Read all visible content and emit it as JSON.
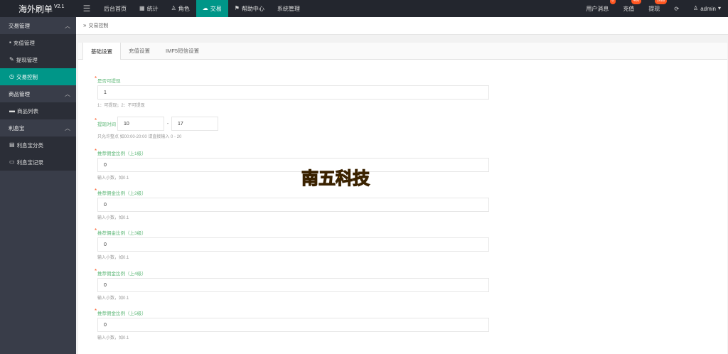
{
  "app": {
    "title": "海外刷单",
    "version": "V2.1"
  },
  "topnav": [
    {
      "label": "后台首页",
      "icon": "home-icon"
    },
    {
      "label": "统计",
      "icon": "chart-icon"
    },
    {
      "label": "角色",
      "icon": "user-icon"
    },
    {
      "label": "交易",
      "icon": "cloud-icon",
      "active": true
    },
    {
      "label": "帮助中心",
      "icon": "flag-icon"
    },
    {
      "label": "系统管理",
      "icon": "none"
    }
  ],
  "topright": {
    "user_msg": {
      "label": "用户消息",
      "badge": "0"
    },
    "recharge": {
      "label": "充值",
      "badge": "460"
    },
    "withdraw": {
      "label": "提现",
      "badge": "2688"
    },
    "admin": "admin"
  },
  "sidebar": {
    "groups": [
      {
        "label": "交易管理",
        "items": [
          "充值管理",
          "提现管理",
          "交易控制"
        ]
      },
      {
        "label": "商品管理",
        "items": [
          "商品列表"
        ]
      },
      {
        "label": "利息宝",
        "items": [
          "利息宝分类",
          "利息宝记录"
        ]
      }
    ]
  },
  "breadcrumb": "交易控制",
  "tabs": [
    "基础设置",
    "充值设置",
    "IMF5短信设置"
  ],
  "form": {
    "withdraw_enabled": {
      "label": "是否可提现",
      "value": "1",
      "hint": "1：可提现；2：不可提现"
    },
    "withdraw_time": {
      "label": "提现时间",
      "from": "10",
      "to": "17",
      "hint": "只允许整点 如00:00-20:00 请直接输入 0 - 20"
    },
    "commission": [
      {
        "label": "推荐佣金比例（上1级）",
        "value": "0",
        "hint": "输入小数，如0.1"
      },
      {
        "label": "推荐佣金比例（上2级）",
        "value": "0",
        "hint": "输入小数，如0.1"
      },
      {
        "label": "推荐佣金比例（上3级）",
        "value": "0",
        "hint": "输入小数，如0.1"
      },
      {
        "label": "推荐佣金比例（上4级）",
        "value": "0",
        "hint": "输入小数，如0.1"
      },
      {
        "label": "推荐佣金比例（上5级）",
        "value": "0",
        "hint": "输入小数，如0.1"
      }
    ]
  },
  "watermark": "南五科技",
  "colors": {
    "accent": "#009688",
    "topbar": "#23262e",
    "sidebar": "#393d49",
    "badge": "#ff5722"
  }
}
